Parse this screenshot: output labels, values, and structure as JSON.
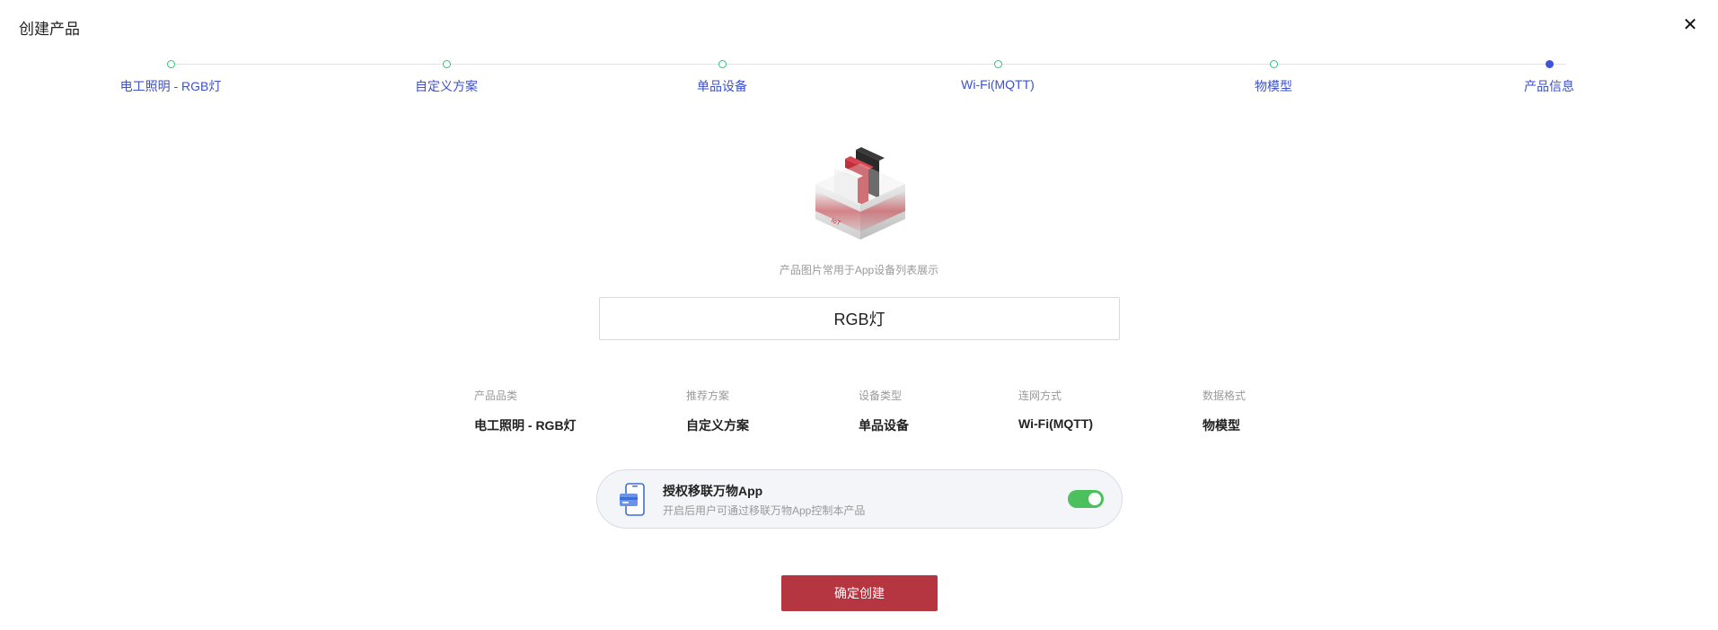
{
  "header": {
    "title": "创建产品",
    "close_symbol": "✕"
  },
  "steps": [
    {
      "label": "电工照明 - RGB灯",
      "state": "done"
    },
    {
      "label": "自定义方案",
      "state": "done"
    },
    {
      "label": "单品设备",
      "state": "done"
    },
    {
      "label": "Wi-Fi(MQTT)",
      "state": "done"
    },
    {
      "label": "物模型",
      "state": "done"
    },
    {
      "label": "产品信息",
      "state": "active"
    }
  ],
  "product": {
    "image_caption": "产品图片常用于App设备列表展示",
    "name_value": "RGB灯"
  },
  "summary": [
    {
      "label": "产品品类",
      "value": "电工照明 - RGB灯"
    },
    {
      "label": "推荐方案",
      "value": "自定义方案"
    },
    {
      "label": "设备类型",
      "value": "单品设备"
    },
    {
      "label": "连网方式",
      "value": "Wi-Fi(MQTT)"
    },
    {
      "label": "数据格式",
      "value": "物模型"
    }
  ],
  "auth": {
    "title": "授权移联万物App",
    "description": "开启后用户可通过移联万物App控制本产品",
    "enabled": true,
    "icon": "phone-app-icon"
  },
  "actions": {
    "confirm_label": "确定创建"
  },
  "colors": {
    "accent": "#3f54d6",
    "done_dot": "#2ec47a",
    "primary_button": "#b53540",
    "toggle_on": "#4cc05c"
  }
}
